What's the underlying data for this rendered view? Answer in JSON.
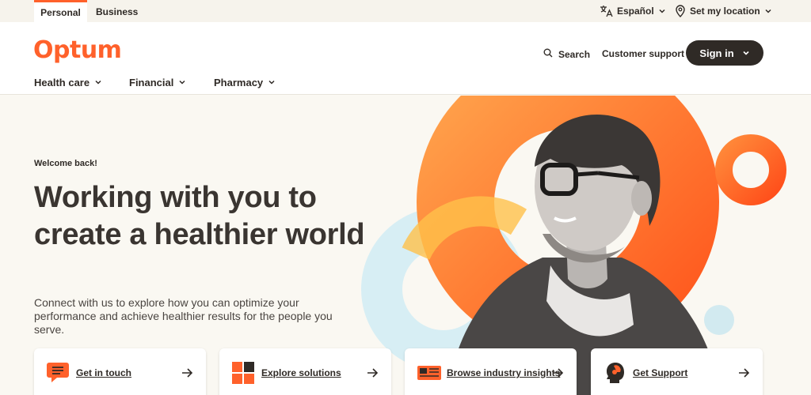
{
  "utility": {
    "tabs": [
      "Personal",
      "Business"
    ],
    "language": "Español",
    "location": "Set my location"
  },
  "header": {
    "logo": "Optum",
    "search": "Search",
    "support": "Customer support",
    "signin": "Sign in",
    "nav": [
      "Health care",
      "Financial",
      "Pharmacy"
    ]
  },
  "hero": {
    "welcome": "Welcome back!",
    "headline": "Working with you to create a healthier world",
    "subtext": "Connect with us to explore how you can optimize your performance and achieve healthier results for the people you serve."
  },
  "cards": [
    {
      "label": "Get in touch",
      "icon": "chat-bubble-icon"
    },
    {
      "label": "Explore solutions",
      "icon": "grid-blocks-icon"
    },
    {
      "label": "Browse industry insights",
      "icon": "newspaper-icon"
    },
    {
      "label": "Get Support",
      "icon": "head-support-icon"
    }
  ],
  "colors": {
    "brand": "#ff612b",
    "dark": "#2f2a26",
    "background": "#faf8f2"
  }
}
